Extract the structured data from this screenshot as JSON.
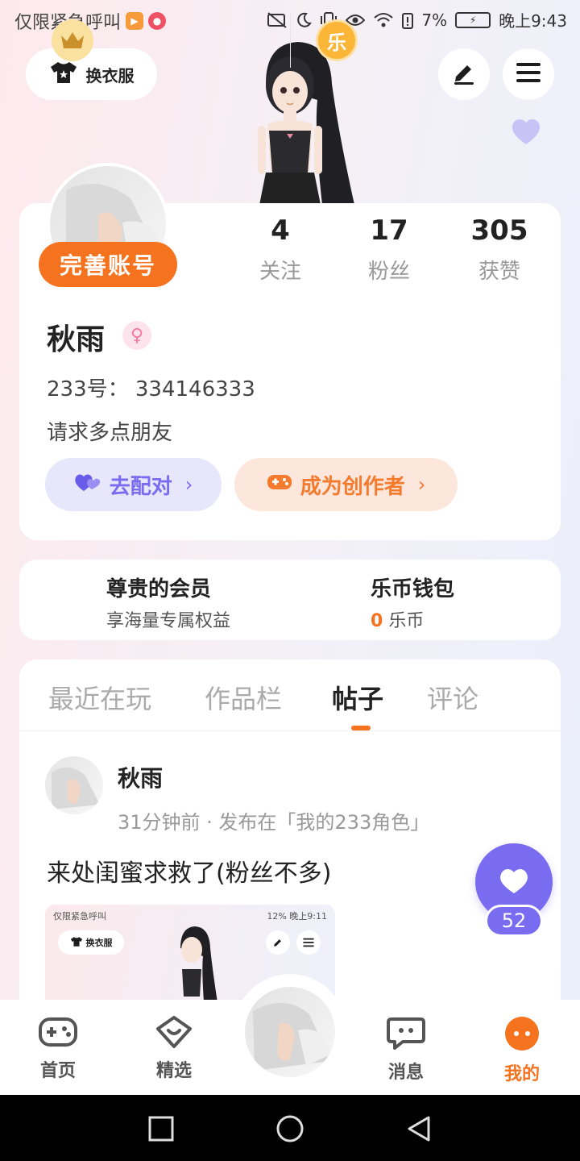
{
  "status_bar": {
    "carrier_text": "仅限紧急呼叫",
    "battery_percent": "7%",
    "time": "晚上9:43"
  },
  "header": {
    "outfit_label": "换衣服"
  },
  "profile": {
    "complete_account_label": "完善账号",
    "stats": [
      {
        "value": "4",
        "label": "关注"
      },
      {
        "value": "17",
        "label": "粉丝"
      },
      {
        "value": "305",
        "label": "获赞"
      }
    ],
    "username": "秋雨",
    "gender_symbol": "♀",
    "account_id": "233号： 334146333",
    "bio": "请求多点朋友",
    "pair_button": "去配对",
    "creator_button": "成为创作者"
  },
  "membership": {
    "title": "尊贵的会员",
    "subtitle": "享海量专属权益"
  },
  "wallet": {
    "title": "乐币钱包",
    "icon_char": "乐",
    "balance": "0",
    "unit": "乐币"
  },
  "tabs": [
    {
      "label": "最近在玩",
      "active": false
    },
    {
      "label": "作品栏",
      "active": false
    },
    {
      "label": "帖子",
      "active": true
    },
    {
      "label": "评论",
      "active": false
    }
  ],
  "post": {
    "author": "秋雨",
    "meta": "31分钟前 · 发布在「我的233角色」",
    "text": "来处闺蜜求救了(粉丝不多)",
    "like_count": "52",
    "thumbnail": {
      "status_left": "仅限紧急呼叫",
      "status_right": "12% 晚上9:11",
      "outfit_label": "换衣服"
    }
  },
  "bottom_nav": [
    {
      "label": "首页",
      "icon": "gamepad-icon",
      "active": false
    },
    {
      "label": "精选",
      "icon": "heart-chat-icon",
      "active": false
    },
    {
      "label": "消息",
      "icon": "message-icon",
      "active": false
    },
    {
      "label": "我的",
      "icon": "me-icon",
      "active": true
    }
  ],
  "colors": {
    "accent_orange": "#f5731f",
    "accent_purple": "#7a6cf0"
  }
}
